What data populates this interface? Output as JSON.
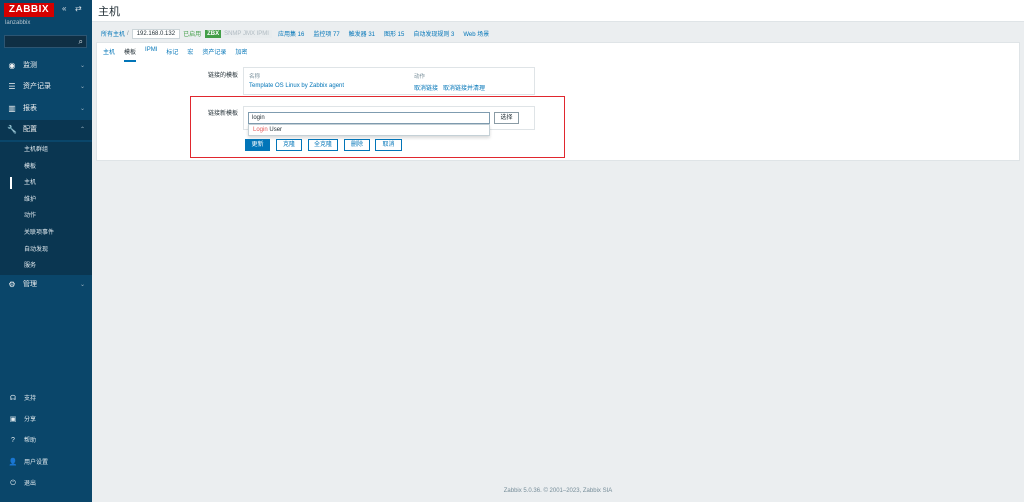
{
  "sidebar": {
    "logo": "ZABBIX",
    "collapse": "«",
    "expand": "⇄",
    "instance": "lanzabbix",
    "menu": [
      {
        "label": "监测",
        "icon": "eye-icon"
      },
      {
        "label": "资产记录",
        "icon": "list-icon"
      },
      {
        "label": "报表",
        "icon": "chart-icon"
      },
      {
        "label": "配置",
        "icon": "wrench-icon"
      }
    ],
    "config_submenu": [
      "主机群组",
      "模板",
      "主机",
      "维护",
      "动作",
      "关联项事件",
      "自动发现",
      "服务"
    ],
    "admin": {
      "label": "管理",
      "icon": "gear-icon"
    },
    "footer": [
      "支持",
      "分享",
      "帮助",
      "用户设置",
      "退出"
    ]
  },
  "header": {
    "title": "主机"
  },
  "breadcrumb": {
    "all_hosts": "所有主机",
    "separator": "/",
    "host": "192.168.0.132",
    "enabled": "已启用",
    "zbx": "ZBX",
    "grey": "SNMP JMX IPMI",
    "links": [
      "应用集 16",
      "监控项 77",
      "触发器 31",
      "图形 15",
      "自动发现规则 3",
      "Web 场景"
    ]
  },
  "tabs": [
    "主机",
    "模板",
    "IPMI",
    "标记",
    "宏",
    "资产记录",
    "加密"
  ],
  "linked": {
    "label": "链接的模板",
    "col_name": "名称",
    "col_action": "动作",
    "template": "Template OS Linux by Zabbix agent",
    "unlink": "取消链接",
    "unlink_clear": "取消链接并清理"
  },
  "new_templates": {
    "label": "链接新模板",
    "input_value": "login",
    "suggestion_match": "Login",
    "suggestion_rest": " User",
    "select": "选择"
  },
  "buttons": {
    "update": "更新",
    "clone": "克隆",
    "full_clone": "全克隆",
    "delete": "删除",
    "cancel": "取消"
  },
  "footer": "Zabbix 5.0.36. © 2001–2023, Zabbix SIA"
}
